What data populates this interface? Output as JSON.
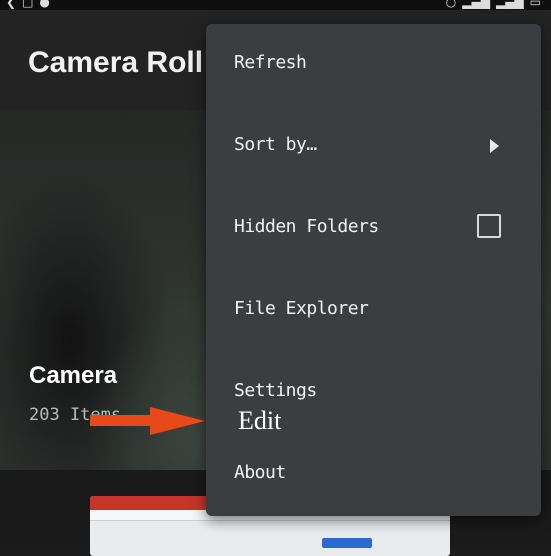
{
  "app": {
    "title": "Camera Roll"
  },
  "folder": {
    "name": "Camera",
    "count": "203 Items"
  },
  "menu": {
    "items": [
      {
        "label": "Refresh"
      },
      {
        "label": "Sort by…"
      },
      {
        "label": "Hidden Folders",
        "checked": false
      },
      {
        "label": "File Explorer"
      },
      {
        "label": "Settings"
      },
      {
        "label": "About"
      }
    ]
  },
  "annotation": {
    "text": "Edit",
    "arrow_color": "#e8491a"
  },
  "colors": {
    "menu_background": "#3a3e41",
    "app_background": "#1b1b1b"
  }
}
